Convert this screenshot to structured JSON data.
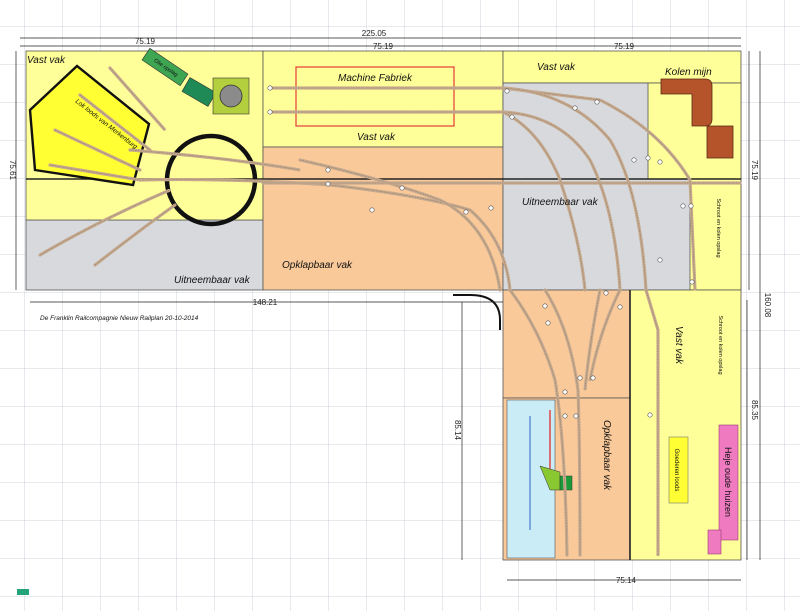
{
  "labels": {
    "vast_vak_left": "Vast  vak",
    "vast_vak_right": "Vast  vak",
    "vast_vak_center": "Vast  vak",
    "vast_vak_lower_right": "Vast  vak",
    "machine_fabriek": "Machine Fabriek",
    "kolen_mijn": "Kolen mijn",
    "uitneembaar_left": "Uitneembaar vak",
    "uitneembaar_right": "Uitneembaar vak",
    "opklapbaar_center": "Opklapbaar vak",
    "opklapbaar_lower": "Opklapbaar vak",
    "lok_loods": "Lok loods van Merkenburg",
    "olie_opslag": "Olie opslag",
    "schroot_1": "Schroot en kolen opslag",
    "schroot_2": "Schroot en kolen opslag",
    "goederen_loods": "Goederen loods",
    "heje_oude_huizen": "Heje oude huizen",
    "footer": "De Franklin Railcompagnie Nieuw Railplan 20-10-2014"
  },
  "dimensions": {
    "total_width": "225.05",
    "seg_left": "75.19",
    "seg_mid": "75.19",
    "seg_right": "75.19",
    "left_height": "75.61",
    "right_height_top": "75.19",
    "bottom_left_width": "148.21",
    "total_height": "160.08",
    "lower_height_left": "85.14",
    "lower_height_right": "85.35",
    "bottom_width": "75.14"
  },
  "colors": {
    "yellow": "#ffff99",
    "peach": "#f9c99a",
    "grey": "#d7d9dd",
    "lightblue": "#c9ecf7",
    "track": "#c4a98f",
    "kolen": "#b5542a",
    "magenta": "#f07ac0"
  }
}
